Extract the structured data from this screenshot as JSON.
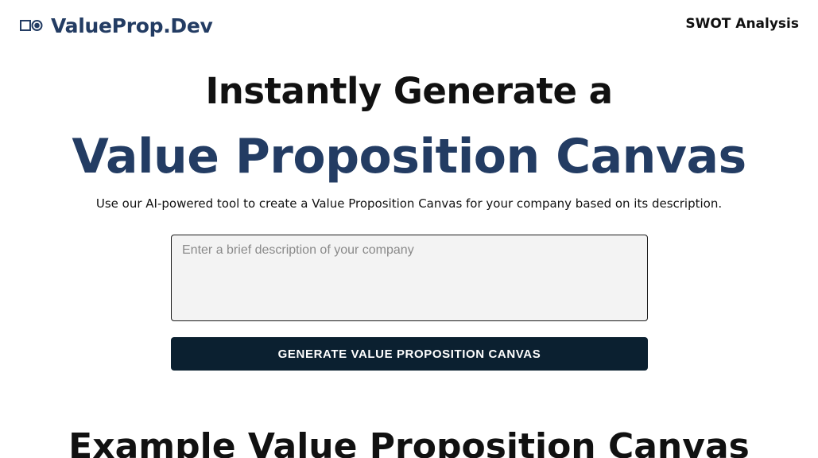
{
  "navbar": {
    "brand_name": "ValueProp.Dev",
    "logo_icon": "square-and-circle-icon",
    "nav_link_label": "SWOT Analysis"
  },
  "hero": {
    "line1": "Instantly Generate a",
    "line2": "Value Proposition Canvas",
    "subtitle": "Use our AI-powered tool to create a Value Proposition Canvas for your company based on its description."
  },
  "form": {
    "description_value": "",
    "description_placeholder": "Enter a brief description of your company",
    "generate_label": "GENERATE VALUE PROPOSITION CANVAS"
  },
  "example": {
    "heading": "Example Value Proposition Canvas"
  },
  "colors": {
    "brand": "#233c63",
    "button_bg": "#0b2030",
    "input_bg": "#f3f3f3",
    "text": "#111111"
  }
}
